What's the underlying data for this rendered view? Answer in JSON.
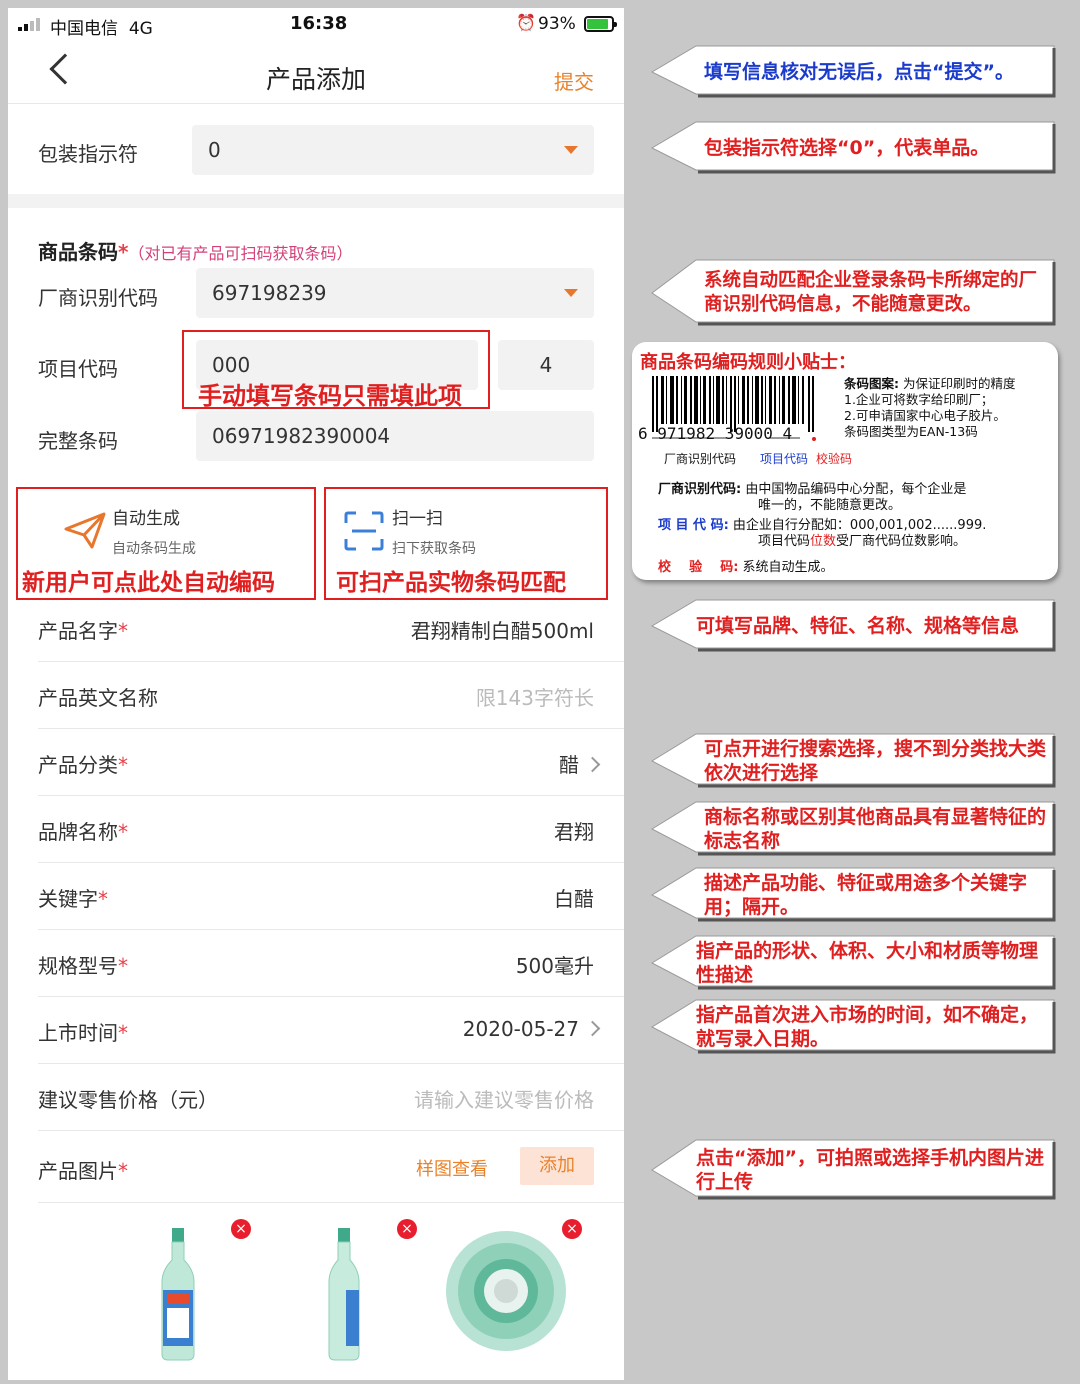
{
  "status_bar": {
    "carrier": "中国电信",
    "network": "4G",
    "time": "16:38",
    "battery": "93%"
  },
  "nav": {
    "title": "产品添加",
    "submit_label": "提交"
  },
  "packaging": {
    "label": "包装指示符",
    "value": "0"
  },
  "barcode": {
    "section_title": "商品条码",
    "required_mark": "*",
    "hint": "（对已有产品可扫码获取条码）",
    "manufacturer_label": "厂商识别代码",
    "manufacturer_value": "697198239",
    "item_label": "项目代码",
    "item_value": "000",
    "check_digit": "4",
    "full_label": "完整条码",
    "full_value": "06971982390004",
    "manual_note": "手动填写条码只需填此项"
  },
  "actions": {
    "auto_title": "自动生成",
    "auto_sub": "自动条码生成",
    "auto_note": "新用户可点此处自动编码",
    "scan_title": "扫一扫",
    "scan_sub": "扫下获取条码",
    "scan_note": "可扫产品实物条码匹配"
  },
  "form_rows": [
    {
      "label": "产品名字",
      "required": "*",
      "value": "君翔精制白醋500ml"
    },
    {
      "label": "产品英文名称",
      "required": "",
      "placeholder": "限143字符长"
    },
    {
      "label": "产品分类",
      "required": "*",
      "value": "醋"
    },
    {
      "label": "品牌名称",
      "required": "*",
      "value": "君翔"
    },
    {
      "label": "关键字",
      "required": "*",
      "value": "白醋"
    },
    {
      "label": "规格型号",
      "required": "*",
      "value": "500毫升"
    },
    {
      "label": "上市时间",
      "required": "*",
      "value": "2020-05-27"
    },
    {
      "label": "建议零售价格（元）",
      "required": "",
      "placeholder": "请输入建议零售价格"
    }
  ],
  "images_row": {
    "label": "产品图片",
    "required": "*",
    "sample_label": "样图查看",
    "add_label": "添加",
    "delete_glyph": "×"
  },
  "callouts": [
    "填写信息核对无误后，点击“提交”。",
    "包装指示符选择“0”，代表单品。",
    "系统自动匹配企业登录条码卡所绑定的厂商识别代码信息，不能随意更改。",
    "可填写品牌、特征、名称、规格等信息",
    "可点开进行搜索选择，搜不到分类找大类依次进行选择",
    "商标名称或区别其他商品具有显著特征的标志名称",
    "描述产品功能、特征或用途多个关键字用；隔开。",
    "指产品的形状、体积、大小和材质等物理性描述",
    "指产品首次进入市场的时间，如不确定，就写录入日期。",
    "点击“添加”，可拍照或选择手机内图片进行上传"
  ],
  "tip_card": {
    "title": "商品条码编码规则小贴士：",
    "barcode_digits": [
      "6",
      "971982",
      "39000",
      "4"
    ],
    "barcode_caption_mfr": "厂商识别代码",
    "barcode_caption_item": "项目代码",
    "barcode_caption_check": "校验码",
    "pattern_heading": "条码图案:",
    "pattern_text_1": "为保证印刷时的精度",
    "pattern_text_2": "1.企业可将数字给印刷厂；",
    "pattern_text_3": "2.可申请国家中心电子胶片。",
    "pattern_text_4": "条码图类型为EAN-13码",
    "mfr_heading": "厂商识别代码:",
    "mfr_text_1": "由中国物品编码中心分配，每个企业是",
    "mfr_text_2": "唯一的，不能随意更改。",
    "item_heading": "项 目 代 码:",
    "item_text_1": "由企业自行分配如：000,001,002......999.",
    "item_text_2a": "项目代码",
    "item_text_2b": "位数",
    "item_text_2c": "受厂商代码位数影响。",
    "check_heading": "校    验    码:",
    "check_text": "系统自动生成。"
  },
  "colors": {
    "accent": "#e8832c",
    "annotation_red": "#e02020",
    "annotation_blue": "#1a3bcc",
    "delete_red": "#e81e2e"
  }
}
